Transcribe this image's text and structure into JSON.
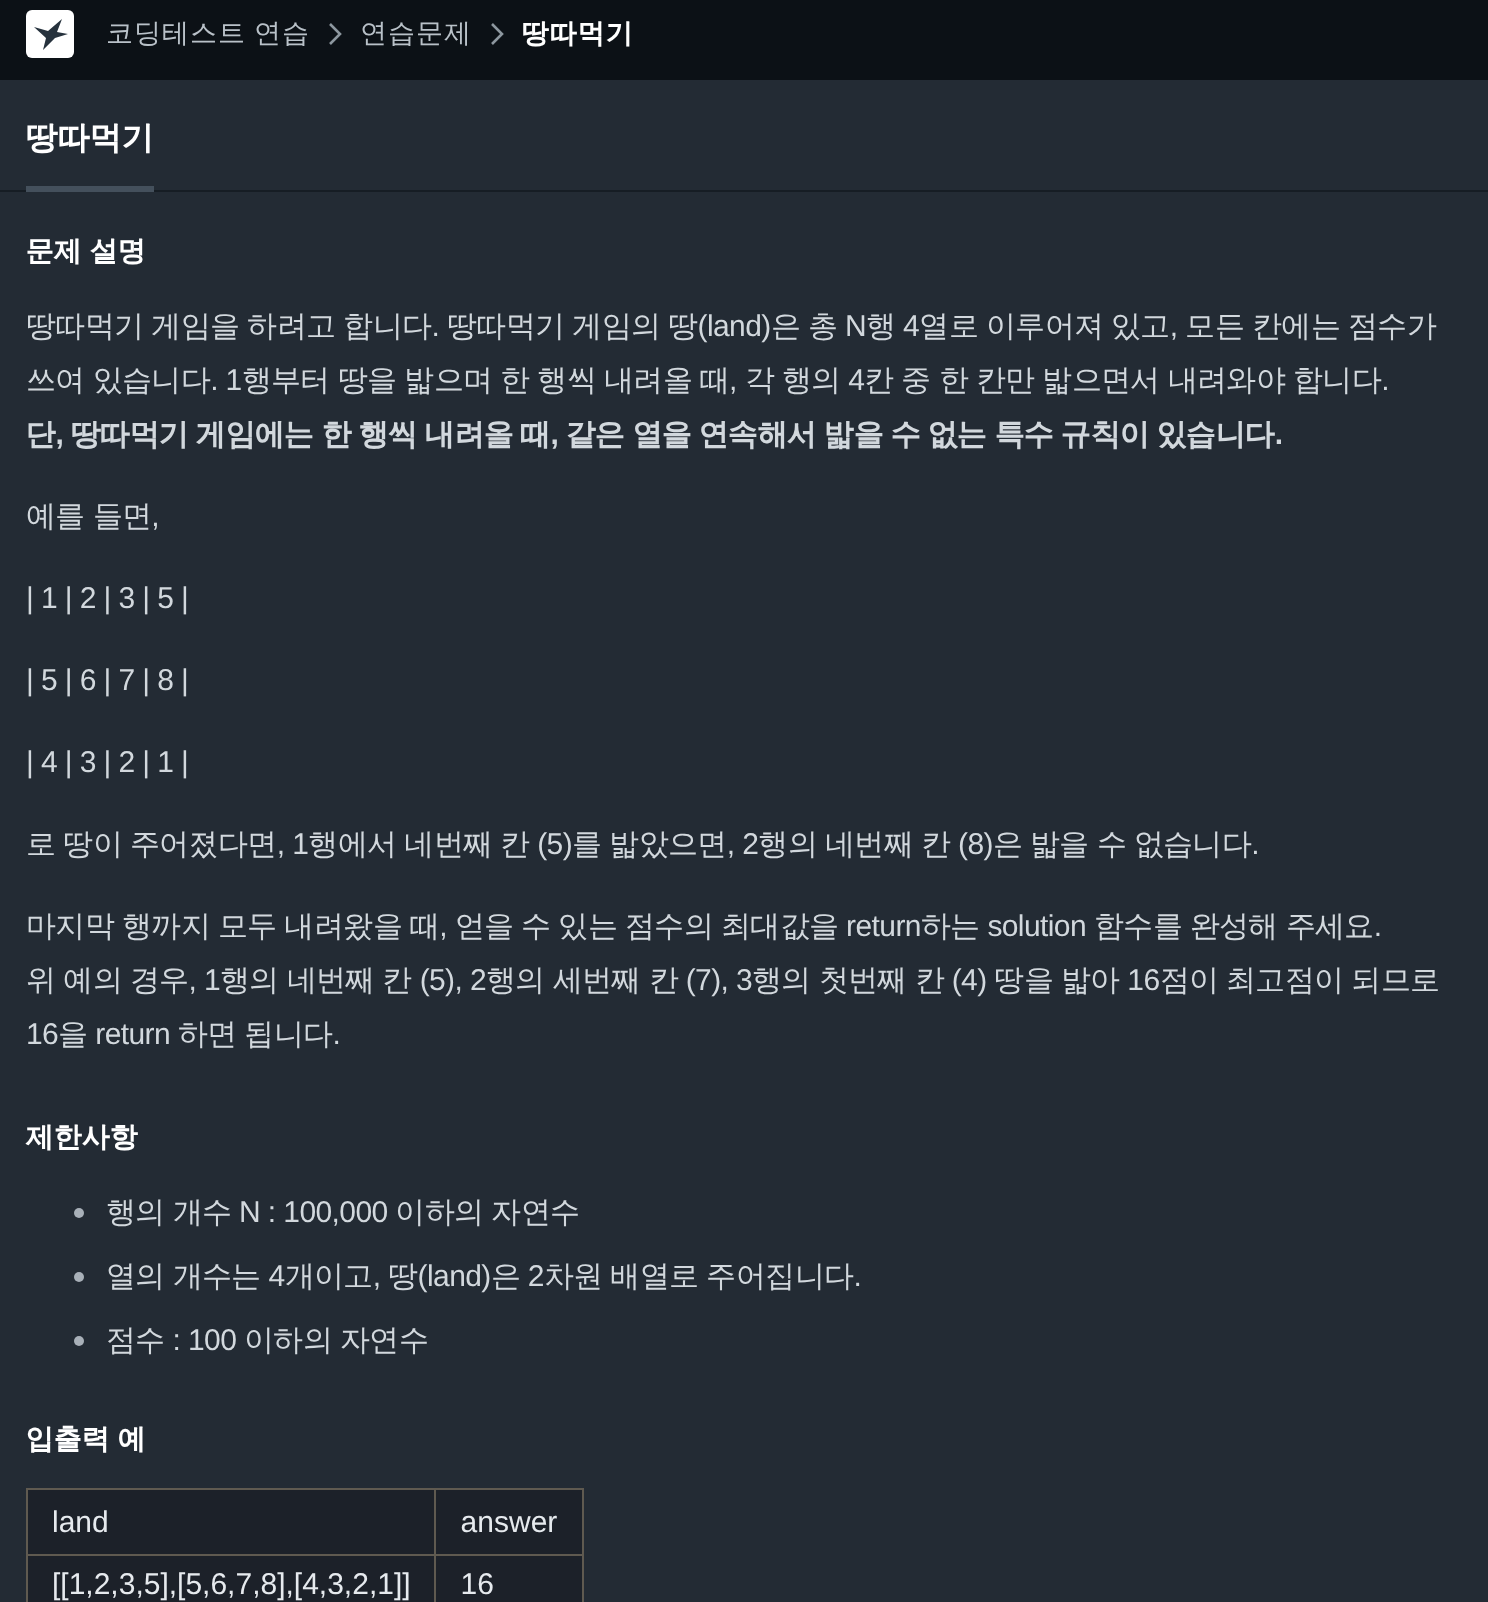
{
  "header": {
    "breadcrumb": [
      {
        "label": "코딩테스트 연습",
        "current": false
      },
      {
        "label": "연습문제",
        "current": false
      },
      {
        "label": "땅따먹기",
        "current": true
      }
    ]
  },
  "tabs": [
    {
      "label": "땅따먹기",
      "selected": true
    }
  ],
  "description": {
    "heading": "문제 설명",
    "paragraphs": [
      "땅따먹기 게임을 하려고 합니다. 땅따먹기 게임의 땅(land)은 총 N행 4열로 이루어져 있고, 모든 칸에는 점수가 쓰여 있습니다. 1행부터 땅을 밟으며 한 행씩 내려올 때, 각 행의 4칸 중 한 칸만 밟으면서 내려와야 합니다.\n**단, 땅따먹기 게임에는 한 행씩 내려올 때, 같은 열을 연속해서 밟을 수 없는 특수 규칙이 있습니다.**",
      "예를 들면,",
      "| 1 | 2 | 3 | 5 |",
      "| 5 | 6 | 7 | 8 |",
      "| 4 | 3 | 2 | 1 |",
      "로 땅이 주어졌다면, 1행에서 네번째 칸 (5)를 밟았으면, 2행의 네번째 칸 (8)은 밟을 수 없습니다.",
      "마지막 행까지 모두 내려왔을 때, 얻을 수 있는 점수의 최대값을 return하는 solution 함수를 완성해 주세요.\n위 예의 경우, 1행의 네번째 칸 (5), 2행의 세번째 칸 (7), 3행의 첫번째 칸 (4) 땅을 밟아 16점이 최고점이 되므로 16을 return 하면 됩니다."
    ]
  },
  "constraints": {
    "heading": "제한사항",
    "items": [
      "행의 개수 N : 100,000 이하의 자연수",
      "열의 개수는 4개이고, 땅(land)은 2차원 배열로 주어집니다.",
      "점수 : 100 이하의 자연수"
    ]
  },
  "examples": {
    "heading": "입출력 예",
    "table": {
      "columns": [
        "land",
        "answer"
      ],
      "rows": [
        [
          "[[1,2,3,5],[5,6,7,8],[4,3,2,1]]",
          "16"
        ]
      ]
    }
  }
}
